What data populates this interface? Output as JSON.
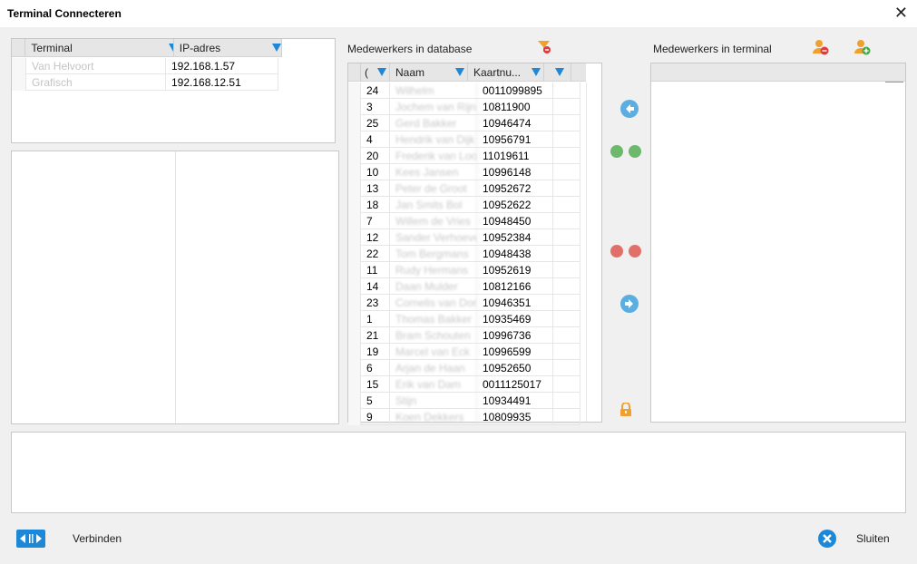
{
  "window": {
    "title": "Terminal Connecteren",
    "close_glyph": "✕"
  },
  "terminals": {
    "headers": [
      "Terminal",
      "IP-adres"
    ],
    "rows": [
      {
        "name": "Van Helvoort",
        "ip": "192.168.1.57"
      },
      {
        "name": "Grafisch",
        "ip": "192.168.12.51"
      }
    ]
  },
  "database": {
    "label": "Medewerkers in database",
    "headers": [
      "(",
      "Naam",
      "Kaartnu..."
    ],
    "rows": [
      {
        "id": "24",
        "name": "Wilhelm",
        "card": "0011099895"
      },
      {
        "id": "3",
        "name": "Jochem van Rijn",
        "card": "10811900"
      },
      {
        "id": "25",
        "name": "Gerd Bakker",
        "card": "10946474"
      },
      {
        "id": "4",
        "name": "Hendrik van Dijk",
        "card": "10956791"
      },
      {
        "id": "20",
        "name": "Frederik van Loon",
        "card": "11019611"
      },
      {
        "id": "10",
        "name": "Kees Jansen",
        "card": "10996148"
      },
      {
        "id": "13",
        "name": "Peter de Groot",
        "card": "10952672"
      },
      {
        "id": "18",
        "name": "Jan Smits Bol",
        "card": "10952622"
      },
      {
        "id": "7",
        "name": "Willem de Vries",
        "card": "10948450"
      },
      {
        "id": "12",
        "name": "Sander Verhoeven",
        "card": "10952384"
      },
      {
        "id": "22",
        "name": "Tom Bergmans",
        "card": "10948438"
      },
      {
        "id": "11",
        "name": "Rudy Hermans",
        "card": "10952619"
      },
      {
        "id": "14",
        "name": "Daan Mulder",
        "card": "10812166"
      },
      {
        "id": "23",
        "name": "Cornelis van Dorp",
        "card": "10946351"
      },
      {
        "id": "1",
        "name": "Thomas Bakker",
        "card": "10935469"
      },
      {
        "id": "21",
        "name": "Bram Schouten",
        "card": "10996736"
      },
      {
        "id": "19",
        "name": "Marcel van Eck",
        "card": "10996599"
      },
      {
        "id": "6",
        "name": "Arjan de Haan",
        "card": "10952650"
      },
      {
        "id": "15",
        "name": "Erik van Dam",
        "card": "0011125017"
      },
      {
        "id": "5",
        "name": "Stijn",
        "card": "10934491"
      },
      {
        "id": "9",
        "name": "Koen Dekkers",
        "card": "10809935"
      }
    ]
  },
  "terminal_panel": {
    "label": "Medewerkers in terminal"
  },
  "footer": {
    "connect_label": "Verbinden",
    "close_label": "Sluiten"
  },
  "colors": {
    "accent": "#1e88d8",
    "green": "#6cb86c",
    "red": "#e2706a",
    "orange": "#f0a030"
  }
}
